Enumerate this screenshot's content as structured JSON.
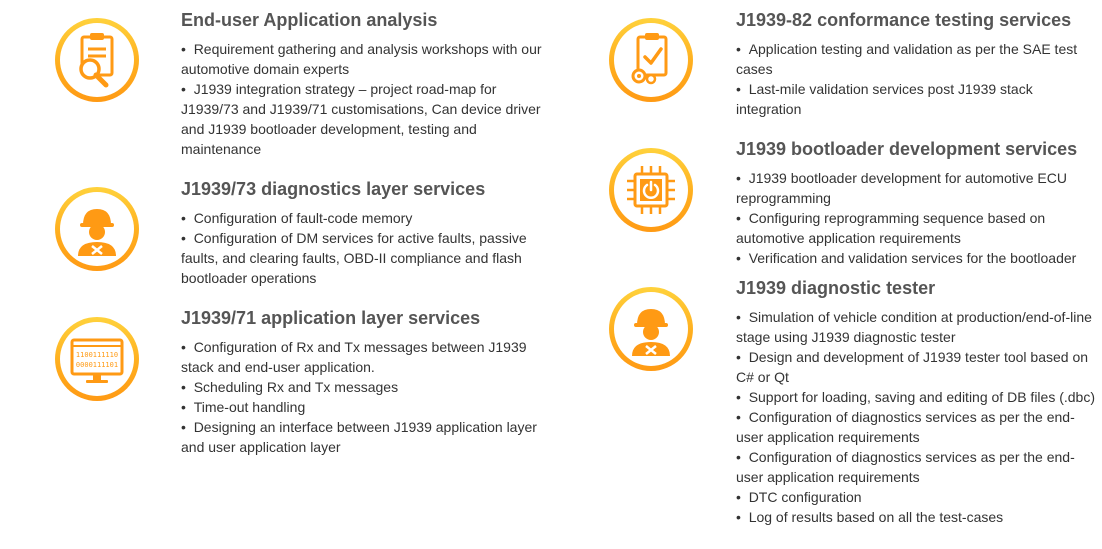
{
  "colors": {
    "accent": "#ff9a14",
    "accent_light": "#ffd23c",
    "heading": "#555555",
    "text": "#333333"
  },
  "services": [
    {
      "icon": "document-magnifier-icon",
      "title": "End-user Application analysis",
      "items": [
        "Requirement gathering and analysis workshops with our automotive domain experts",
        "J1939 integration strategy – project road-map for J1939/73 and J1939/71 customisations, Can device driver and J1939 bootloader development, testing and maintenance"
      ]
    },
    {
      "icon": "engineer-icon",
      "title": "J1939/73 diagnostics layer services",
      "items": [
        "Configuration of fault-code memory",
        "Configuration of DM services for active faults, passive faults, and clearing faults, OBD-II compliance and flash bootloader operations"
      ]
    },
    {
      "icon": "binary-monitor-icon",
      "title": "J1939/71 application layer services",
      "items": [
        "Configuration of Rx and Tx messages between J1939 stack and end-user application.",
        "Scheduling Rx and Tx messages",
        "Time-out handling",
        "Designing an interface between J1939 application layer and user application layer"
      ]
    },
    {
      "icon": "clipboard-check-icon",
      "title": "J1939-82 conformance testing services",
      "items": [
        "Application testing and validation as per the SAE test cases",
        "Last-mile validation services post J1939 stack integration"
      ]
    },
    {
      "icon": "chip-power-icon",
      "title": "J1939 bootloader development services",
      "items": [
        "J1939 bootloader development for automotive ECU reprogramming",
        "Configuring reprogramming sequence based on automotive application requirements",
        "Verification and validation services for the bootloader"
      ]
    },
    {
      "icon": "engineer-icon",
      "title": "J1939 diagnostic tester",
      "items": [
        "Simulation of vehicle condition at production/end-of-line stage using J1939 diagnostic tester",
        "Design and development of J1939 tester tool based on C# or Qt",
        "Support for loading, saving and editing of DB files (.dbc)",
        "Configuration of diagnostics services as per the end-user application requirements",
        "Configuration of diagnostics services as per the end-user application requirements",
        "DTC configuration",
        "Log of results based on all the test-cases"
      ]
    }
  ]
}
